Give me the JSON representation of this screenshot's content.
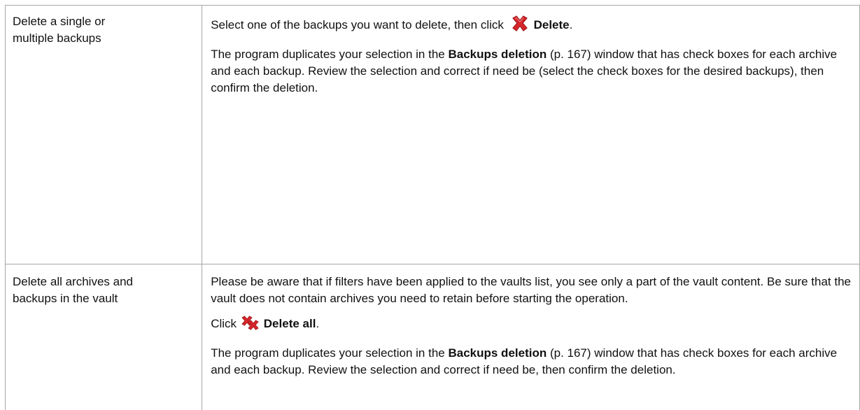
{
  "rows": [
    {
      "action": "Delete a single or\nmultiple backups",
      "p1": {
        "prefix": "Select one of the backups you want to delete, then click ",
        "icon": "delete-x-icon",
        "bold": "Delete",
        "suffix": "."
      },
      "p2": {
        "prefix": "The program duplicates your selection in the ",
        "bold": "Backups deletion",
        "middle": " (p. 167) window that has check boxes for each archive and each backup. Review the selection and correct if need be (select the check boxes for the desired backups), then confirm the deletion."
      }
    },
    {
      "action": "Delete all archives and\nbackups in the vault",
      "p1": "Please be aware that if filters have been applied to the vaults list, you see only a part of the vault content. Be sure that the vault does not contain archives you need to retain before starting the operation.",
      "p2": {
        "prefix": "Click ",
        "icon": "delete-all-icon",
        "bold": "Delete all",
        "suffix": "."
      },
      "p3": {
        "prefix": "The program duplicates your selection in the ",
        "bold": "Backups deletion",
        "middle": " (p. 167) window that has check boxes for each archive and each backup. Review the selection and correct if need be, then confirm the deletion."
      }
    }
  ],
  "colors": {
    "border": "#a6a6a6",
    "icon_red": "#d7262b",
    "icon_red_dark": "#a3171b"
  }
}
